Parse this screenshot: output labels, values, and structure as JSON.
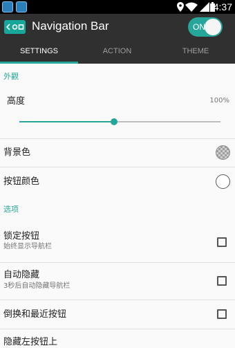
{
  "status_bar": {
    "time": "4:37",
    "notification_icons": [
      "notification-app-icon",
      "notification-app-icon"
    ],
    "system_icons": [
      "location-icon",
      "wifi-icon",
      "signal-icon",
      "battery-icon"
    ]
  },
  "app_bar": {
    "title": "Navigation Bar",
    "logo_icon": "navigation-bar-icon",
    "switch_label": "ON",
    "switch_on": true
  },
  "tabs": [
    {
      "label": "SETTINGS",
      "active": true
    },
    {
      "label": "ACTION",
      "active": false
    },
    {
      "label": "THEME",
      "active": false
    }
  ],
  "sections": {
    "appearance": {
      "header": "外觀",
      "height_label": "高度",
      "height_value": "100%",
      "height_slider_fraction": 0.47,
      "background_label": "背景色",
      "button_color_label": "按钮颜色"
    },
    "options": {
      "header": "选项",
      "lock_label": "锁定按钮",
      "lock_sub": "始终显示导航栏",
      "lock_checked": false,
      "autohide_label": "自动隐藏",
      "autohide_sub": "3秒后自动隐藏导航栏",
      "autohide_checked": false,
      "swap_label": "倒换和最近按钮",
      "swap_checked": false,
      "partial_label": "隐藏左按钮上"
    }
  },
  "colors": {
    "accent": "#26a69a",
    "app_bar": "#303030",
    "status_bar": "#000000",
    "background": "#fafafa"
  }
}
